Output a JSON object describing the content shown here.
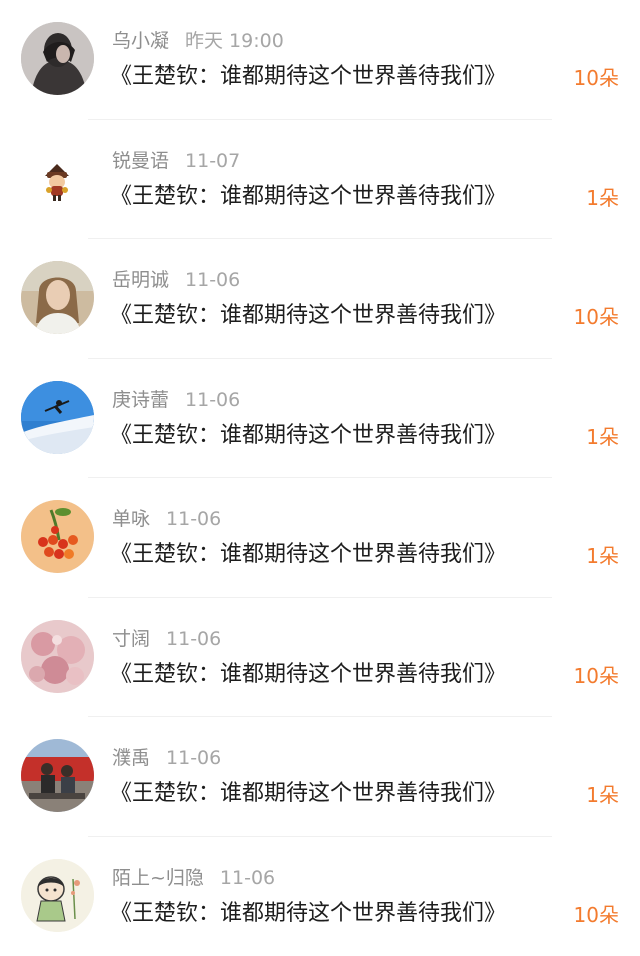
{
  "colors": {
    "gift_count": "#f37b2e",
    "username": "#8e8e8e",
    "timestamp": "#a6a6a6",
    "title": "#1d1d1d"
  },
  "items": [
    {
      "name": "乌小凝",
      "time": "昨天 19:00",
      "title": "《王楚钦：谁都期待这个世界善待我们》",
      "gift": "10朵",
      "avatar": "avatar-dark-portrait"
    },
    {
      "name": "锐曼语",
      "time": "11-07",
      "title": "《王楚钦：谁都期待这个世界善待我们》",
      "gift": "1朵",
      "avatar": "avatar-cartoon-figure"
    },
    {
      "name": "岳明诚",
      "time": "11-06",
      "title": "《王楚钦：谁都期待这个世界善待我们》",
      "gift": "10朵",
      "avatar": "avatar-woman-portrait"
    },
    {
      "name": "庚诗蕾",
      "time": "11-06",
      "title": "《王楚钦：谁都期待这个世界善待我们》",
      "gift": "1朵",
      "avatar": "avatar-skier-sky"
    },
    {
      "name": "单咏",
      "time": "11-06",
      "title": "《王楚钦：谁都期待这个世界善待我们》",
      "gift": "1朵",
      "avatar": "avatar-red-berries"
    },
    {
      "name": "寸阔",
      "time": "11-06",
      "title": "《王楚钦：谁都期待这个世界善待我们》",
      "gift": "10朵",
      "avatar": "avatar-pink-flowers"
    },
    {
      "name": "濮禹",
      "time": "11-06",
      "title": "《王楚钦：谁都期待这个世界善待我们》",
      "gift": "1朵",
      "avatar": "avatar-group-photo"
    },
    {
      "name": "陌上~归隐",
      "time": "11-06",
      "title": "《王楚钦：谁都期待这个世界善待我们》",
      "gift": "10朵",
      "avatar": "avatar-cartoon-girl"
    }
  ]
}
